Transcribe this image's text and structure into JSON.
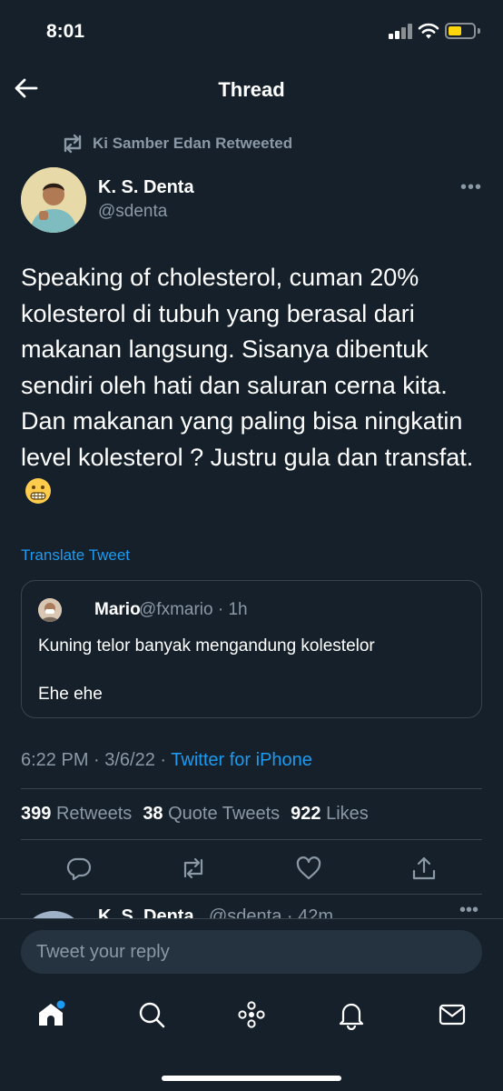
{
  "status_bar": {
    "time": "8:01",
    "battery_color": "#ffd60a",
    "icons": [
      "signal-icon",
      "wifi-icon",
      "battery-icon"
    ]
  },
  "header": {
    "title": "Thread",
    "back_icon": "arrow-left-icon"
  },
  "tweet": {
    "retweet_context": "Ki Samber Edan Retweeted",
    "author_name": "K. S. Denta",
    "author_handle": "@sdenta",
    "body": "Speaking of cholesterol, cuman 20% kolesterol di tubuh yang berasal dari makanan langsung. Sisanya dibentuk sendiri oleh hati dan saluran cerna kita. Dan makanan yang paling bisa ningkatin level kolesterol ? Justru gula dan transfat.",
    "emoji": "grimacing-face",
    "translate_label": "Translate Tweet",
    "quote": {
      "author_name": "Mario",
      "author_handle": "@fxmario · 1h",
      "text_line1": "Kuning telor banyak mengandung kolestelor",
      "text_line2": "Ehe ehe"
    },
    "timestamp": "6:22 PM · 3/6/22 · ",
    "source": "Twitter for iPhone",
    "stats": {
      "retweets_count": "399",
      "retweets_label": "Retweets",
      "quotes_count": "38",
      "quotes_label": "Quote Tweets",
      "likes_count": "922",
      "likes_label": "Likes"
    },
    "actions": [
      "reply-icon",
      "retweet-icon",
      "like-icon",
      "share-icon"
    ]
  },
  "next_tweet": {
    "author_name": "K. S. Denta",
    "author_handle": "@sdenta · 42m"
  },
  "reply": {
    "placeholder": "Tweet your reply"
  },
  "tab_bar": {
    "items": [
      "home-icon",
      "search-icon",
      "spaces-icon",
      "notifications-icon",
      "messages-icon"
    ],
    "accent": "#1d9bf0"
  },
  "colors": {
    "background": "#15202b",
    "secondary_text": "#8b98a5",
    "link": "#1d9bf0",
    "border": "#38444d"
  }
}
